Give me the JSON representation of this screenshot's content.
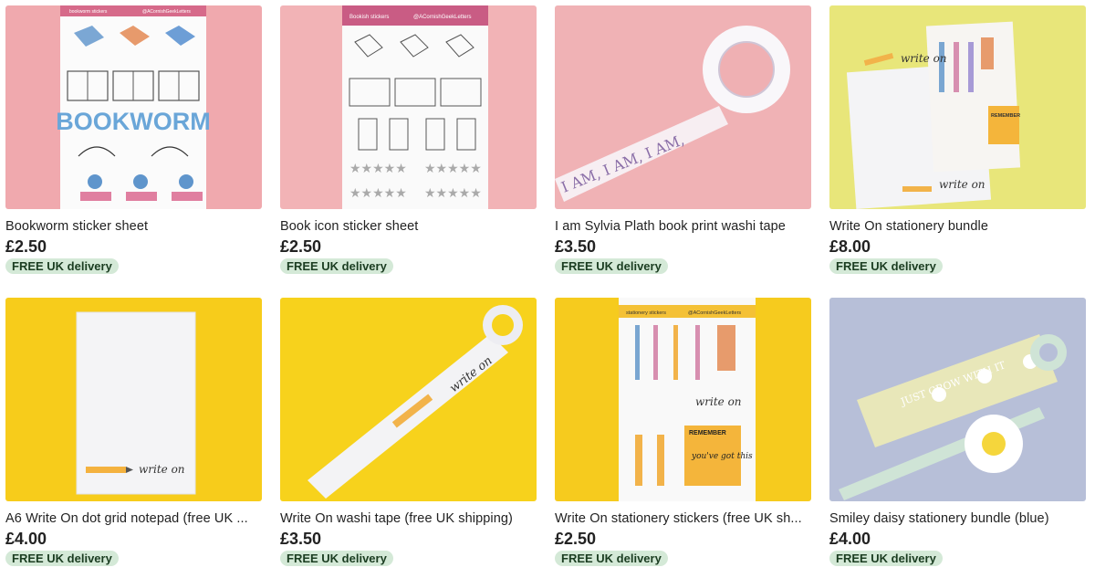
{
  "listings": [
    {
      "title": "Bookworm sticker sheet",
      "price": "£2.50",
      "badge": "FREE UK delivery",
      "image": {
        "sheet_header_left": "bookworm stickers",
        "sheet_header_right": "@ACornishGeekLetters",
        "word": "BOOKWORM",
        "background": "#f0a9ae"
      }
    },
    {
      "title": "Book icon sticker sheet",
      "price": "£2.50",
      "badge": "FREE UK delivery",
      "image": {
        "sheet_header_left": "Bookish stickers",
        "sheet_header_right": "@ACornishGeekLetters",
        "background": "#f2b3b6"
      }
    },
    {
      "title": "I am Sylvia Plath book print washi tape",
      "price": "£3.50",
      "badge": "FREE UK delivery",
      "image": {
        "tape_text": "I AM, I AM, I AM,",
        "background": "#f0b2b5"
      }
    },
    {
      "title": "Write On stationery bundle",
      "price": "£8.00",
      "badge": "FREE UK delivery",
      "image": {
        "script_text": "write on",
        "sticky_note": "REMEMBER",
        "background": "#e8e67a"
      }
    },
    {
      "title": "A6 Write On dot grid notepad (free UK ...",
      "price": "£4.00",
      "badge": "FREE UK delivery",
      "image": {
        "script_text": "write on",
        "background": "#f7cc1b"
      }
    },
    {
      "title": "Write On washi tape (free UK shipping)",
      "price": "£3.50",
      "badge": "FREE UK delivery",
      "image": {
        "script_text": "write on",
        "background": "#f7d21c"
      }
    },
    {
      "title": "Write On stationery stickers (free UK sh...",
      "price": "£2.50",
      "badge": "FREE UK delivery",
      "image": {
        "sheet_header_left": "stationery stickers",
        "sheet_header_right": "@ACornishGeekLetters",
        "script_text": "write on",
        "sticky_note_title": "REMEMBER",
        "sticky_note_body": "you've got this",
        "background": "#f6cb1e"
      }
    },
    {
      "title": "Smiley daisy stationery bundle (blue)",
      "price": "£4.00",
      "badge": "FREE UK delivery",
      "image": {
        "tape_text": "JUST GROW WITH IT",
        "background": "#b7bfd8"
      }
    }
  ]
}
